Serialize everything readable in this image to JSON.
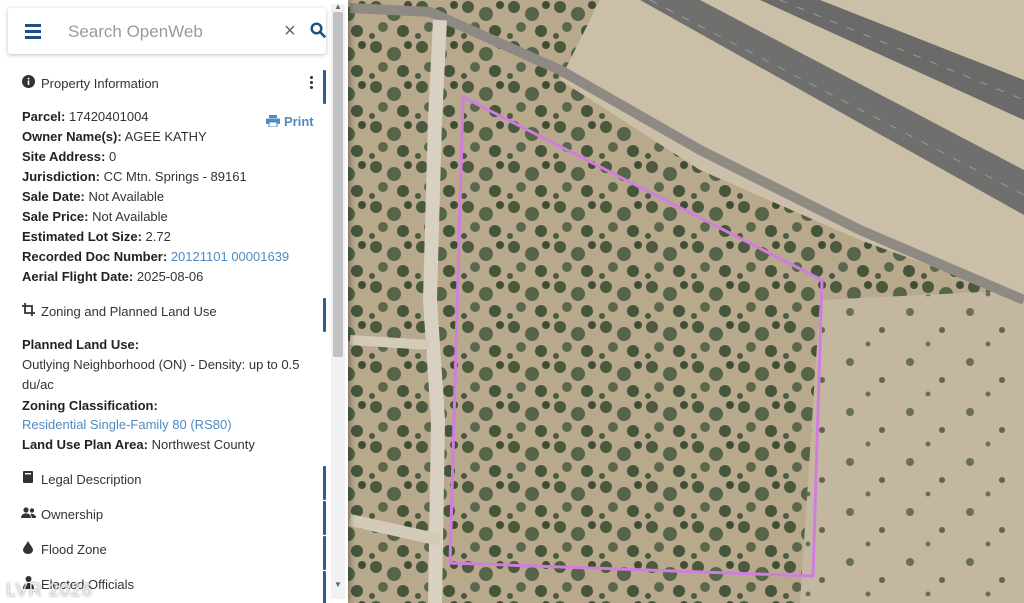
{
  "search": {
    "placeholder": "Search OpenWeb"
  },
  "property": {
    "header": "Property Information",
    "print_label": "Print",
    "fields": [
      {
        "label": "Parcel:",
        "value": "17420401004"
      },
      {
        "label": "Owner Name(s):",
        "value": "AGEE KATHY"
      },
      {
        "label": "Site Address:",
        "value": "0"
      },
      {
        "label": "Jurisdiction:",
        "value": "CC Mtn. Springs - 89161"
      },
      {
        "label": "Sale Date:",
        "value": "Not Available"
      },
      {
        "label": "Sale Price:",
        "value": "Not Available"
      },
      {
        "label": "Estimated Lot Size:",
        "value": "2.72"
      },
      {
        "label": "Recorded Doc Number:",
        "value": "20121101 00001639"
      },
      {
        "label": "Aerial Flight Date:",
        "value": "2025-08-06"
      }
    ]
  },
  "zoning": {
    "header": "Zoning and Planned Land Use",
    "planned_label": "Planned Land Use:",
    "planned_value": "Outlying Neighborhood (ON) - Density: up to 0.5 du/ac",
    "zoning_label": "Zoning Classification:",
    "zoning_value": "Residential Single-Family 80 (RS80)",
    "plan_area_label": "Land Use Plan Area:",
    "plan_area_value": "Northwest County"
  },
  "sections": {
    "legal": "Legal Description",
    "ownership": "Ownership",
    "flood": "Flood Zone",
    "officials": "Elected Officials"
  },
  "watermark": "LVR 2026",
  "colors": {
    "accent": "#2f5d8f",
    "link": "#4f8ac0",
    "parcel_outline": "#d07de0"
  }
}
